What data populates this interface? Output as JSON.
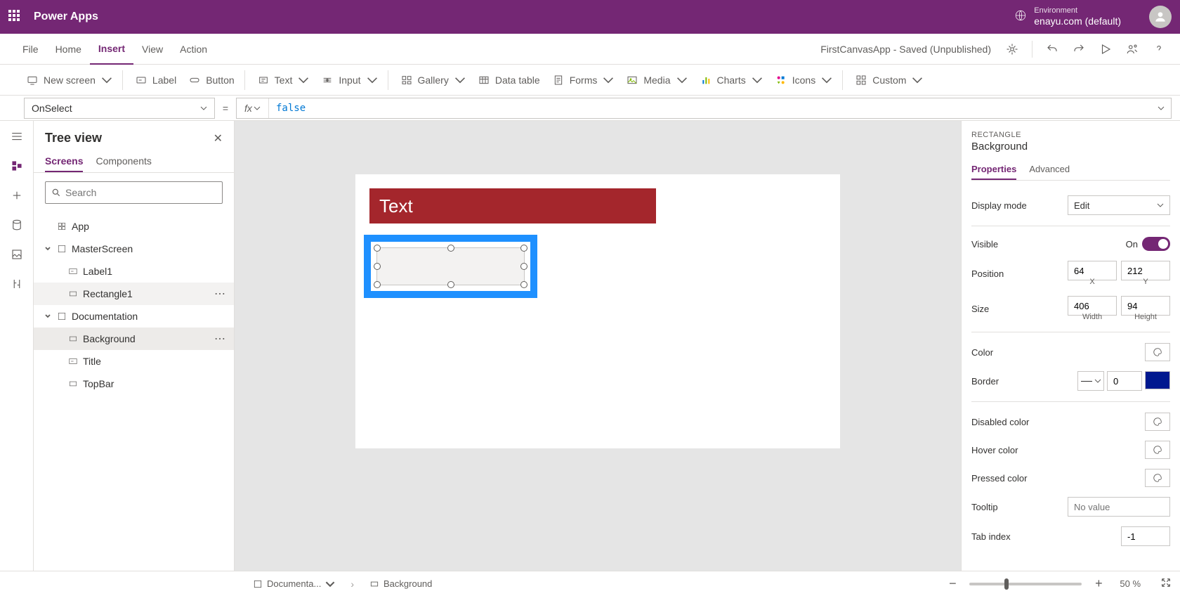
{
  "topbar": {
    "title": "Power Apps",
    "env_label": "Environment",
    "env_value": "enayu.com (default)"
  },
  "menubar": {
    "items": [
      "File",
      "Home",
      "Insert",
      "View",
      "Action"
    ],
    "active_index": 2,
    "doc_status": "FirstCanvasApp - Saved (Unpublished)"
  },
  "ribbon": {
    "new_screen": "New screen",
    "label": "Label",
    "button": "Button",
    "text": "Text",
    "input": "Input",
    "gallery": "Gallery",
    "data_table": "Data table",
    "forms": "Forms",
    "media": "Media",
    "charts": "Charts",
    "icons": "Icons",
    "custom": "Custom"
  },
  "formulabar": {
    "property": "OnSelect",
    "fx": "fx",
    "value": "false"
  },
  "treeview": {
    "title": "Tree view",
    "tabs": [
      "Screens",
      "Components"
    ],
    "active_tab": 0,
    "search_placeholder": "Search",
    "items": {
      "app": "App",
      "master_screen": "MasterScreen",
      "label1": "Label1",
      "rectangle1": "Rectangle1",
      "documentation": "Documentation",
      "background": "Background",
      "title_item": "Title",
      "topbar_item": "TopBar"
    }
  },
  "canvas": {
    "text_content": "Text"
  },
  "properties": {
    "type": "RECTANGLE",
    "name": "Background",
    "tabs": [
      "Properties",
      "Advanced"
    ],
    "active_tab": 0,
    "display_mode_label": "Display mode",
    "display_mode_value": "Edit",
    "visible_label": "Visible",
    "visible_value": "On",
    "position_label": "Position",
    "position_x": "64",
    "position_y": "212",
    "x_label": "X",
    "y_label": "Y",
    "size_label": "Size",
    "size_w": "406",
    "size_h": "94",
    "w_label": "Width",
    "h_label": "Height",
    "color_label": "Color",
    "border_label": "Border",
    "border_width": "0",
    "disabled_color_label": "Disabled color",
    "hover_color_label": "Hover color",
    "pressed_color_label": "Pressed color",
    "tooltip_label": "Tooltip",
    "tooltip_placeholder": "No value",
    "tab_index_label": "Tab index",
    "tab_index_value": "-1"
  },
  "statusbar": {
    "crumb1": "Documenta...",
    "crumb2": "Background",
    "zoom_value": "50",
    "zoom_pct": "%"
  }
}
